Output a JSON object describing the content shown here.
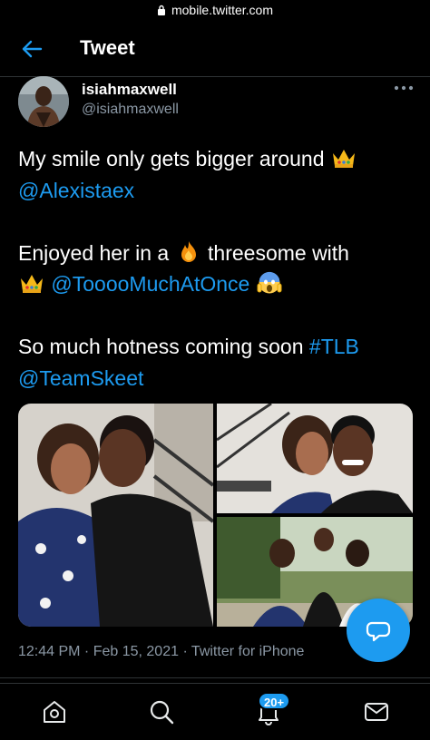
{
  "browser": {
    "url": "mobile.twitter.com"
  },
  "header": {
    "title": "Tweet"
  },
  "tweet": {
    "display_name": "isiahmaxwell",
    "handle": "@isiahmaxwell",
    "lines": {
      "l1": "My smile only gets bigger around",
      "l2": "@Alexistaex",
      "l3": "Enjoyed her in a",
      "l3b": "threesome with",
      "l4": "@ToooοMuchAtOnce",
      "l5": "So much hotness coming soon",
      "l5b": "#TLB",
      "l6": "@TeamSkeet"
    },
    "timestamp": "12:44 PM · Feb 15, 2021 · Twitter for iPhone",
    "emojis": [
      "crown-emoji",
      "fire-emoji",
      "crown-emoji",
      "screaming-emoji"
    ]
  },
  "nav": {
    "items": [
      "home-icon",
      "search-icon",
      "notifications-icon",
      "messages-icon"
    ],
    "notifications_badge": "20+"
  },
  "colors": {
    "accent": "#1d9bf0",
    "background": "#000000",
    "secondary_text": "#8b98a5"
  }
}
